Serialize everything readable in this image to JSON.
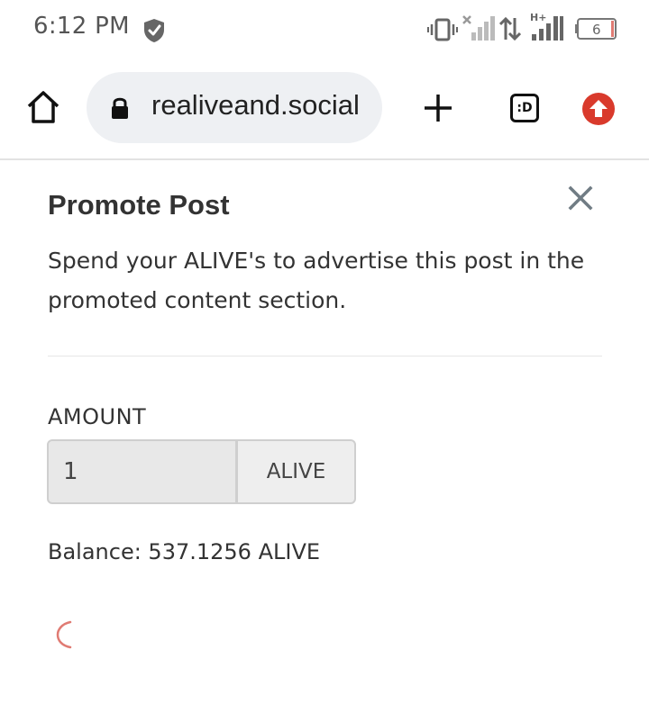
{
  "status_bar": {
    "time": "6:12 PM",
    "battery_level": "6",
    "network_type": "H+"
  },
  "browser": {
    "url": "realiveand.social",
    "tabs_label": ":D"
  },
  "modal": {
    "title": "Promote Post",
    "description": "Spend your ALIVE's to advertise this post in the promoted content section.",
    "amount_label": "AMOUNT",
    "amount_value": "1",
    "amount_unit": "ALIVE",
    "balance_text": "Balance: 537.1256 ALIVE"
  },
  "colors": {
    "accent_red": "#d93a2c",
    "spinner": "#e07b73"
  }
}
